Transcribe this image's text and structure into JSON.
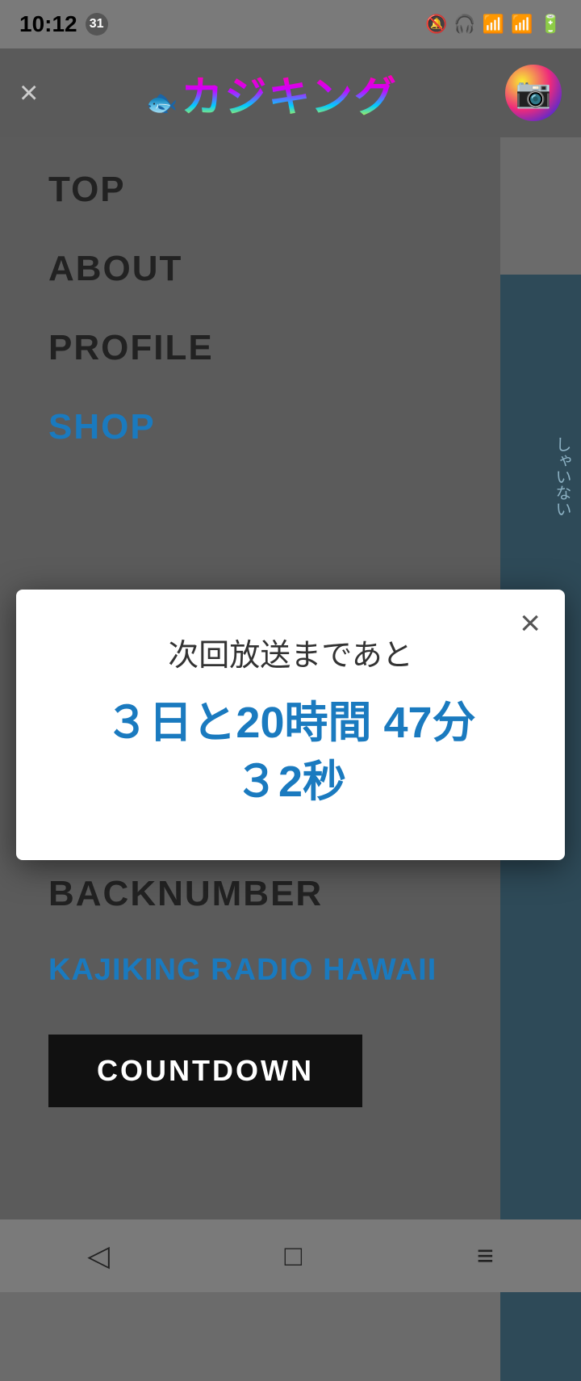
{
  "statusBar": {
    "time": "10:12",
    "badge": "31",
    "icons": "🔇 🔕 🎧 📶 📶 🔋"
  },
  "header": {
    "closeLabel": "×",
    "logoText": "カジキング",
    "instagramIcon": "📷"
  },
  "menu": {
    "items": [
      {
        "label": "TOP",
        "active": false
      },
      {
        "label": "ABOUT",
        "active": false
      },
      {
        "label": "PROFILE",
        "active": false
      },
      {
        "label": "SHOP",
        "active": true
      },
      {
        "label": "BACKNUMBER",
        "active": false
      }
    ],
    "radioItem": "KAJIKING RADIO HAWAII",
    "countdownButton": "COUNTDOWN"
  },
  "modal": {
    "closeLabel": "×",
    "subtitle": "次回放送まであと",
    "countdown": "３日と20時間 47分\n３2秒"
  },
  "bottomNav": {
    "back": "◁",
    "home": "□",
    "menu": "≡"
  },
  "rightEdge": {
    "letters": "しゃいない"
  }
}
